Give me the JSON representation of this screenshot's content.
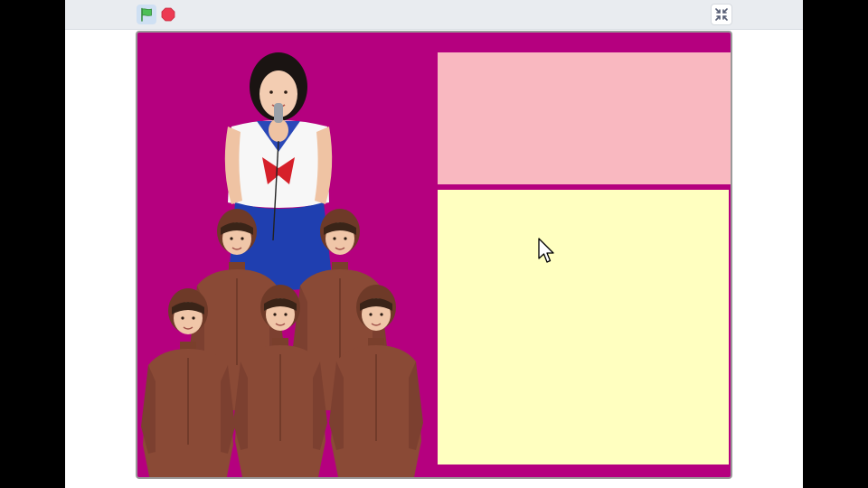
{
  "toolbar": {
    "green_flag_icon": "green-flag-icon",
    "stop_icon": "stop-icon",
    "fullscreen_icon": "shrink-icon"
  },
  "colors": {
    "stage_background": "#b5007f",
    "top_panel": "#f9b8c0",
    "bottom_panel": "#ffffc0",
    "flag_green": "#4cbf56",
    "stop_red": "#ec3a52",
    "costume_brown": "#8a4a36",
    "sailor_blue": "#1f3fb0",
    "sailor_red": "#d6202a"
  },
  "stage": {
    "sprites": [
      {
        "name": "singer-sailor-costume"
      },
      {
        "name": "dancer-brown-suit-1"
      },
      {
        "name": "dancer-brown-suit-2"
      },
      {
        "name": "dancer-brown-suit-3"
      },
      {
        "name": "dancer-brown-suit-4"
      },
      {
        "name": "dancer-brown-suit-5"
      }
    ]
  }
}
